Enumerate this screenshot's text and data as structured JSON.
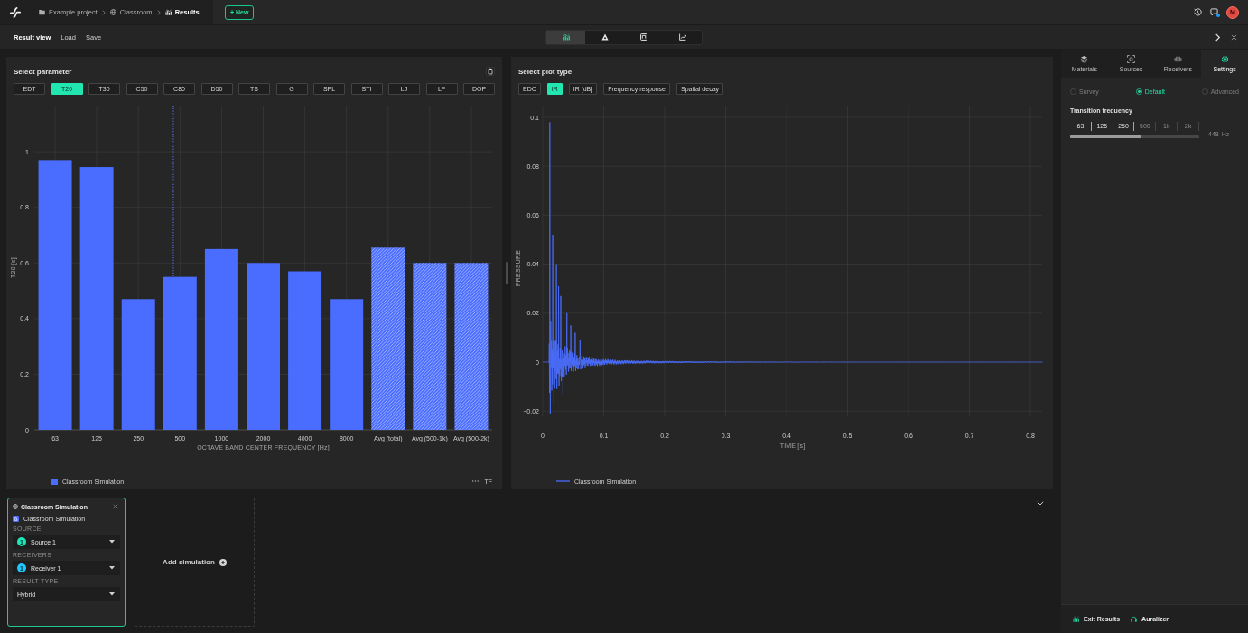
{
  "top_bar": {
    "breadcrumbs": [
      {
        "label": "Example project",
        "kind": "project",
        "selected": false
      },
      {
        "label": "Classroom",
        "kind": "model",
        "selected": false
      },
      {
        "label": "Results",
        "kind": "results",
        "selected": true
      }
    ],
    "new_button": "+ New",
    "chat_notification": true,
    "avatar": "M"
  },
  "toolbar": {
    "items": [
      {
        "label": "Result view",
        "selected": true
      },
      {
        "label": "Load",
        "selected": false
      },
      {
        "label": "Save",
        "selected": false
      }
    ],
    "views": [
      {
        "kind": "bar_chart",
        "selected": true
      },
      {
        "kind": "pyramid",
        "selected": false
      },
      {
        "kind": "framed_square",
        "selected": false
      },
      {
        "kind": "trend",
        "selected": false
      }
    ]
  },
  "parameter_panel": {
    "title": "Select parameter",
    "parameters": [
      {
        "label": "EDT",
        "selected": false
      },
      {
        "label": "T20",
        "selected": true
      },
      {
        "label": "T30",
        "selected": false
      },
      {
        "label": "C50",
        "selected": false
      },
      {
        "label": "C80",
        "selected": false
      },
      {
        "label": "D50",
        "selected": false
      },
      {
        "label": "TS",
        "selected": false
      },
      {
        "label": "G",
        "selected": false
      },
      {
        "label": "SPL",
        "selected": false
      },
      {
        "label": "STI",
        "selected": false
      },
      {
        "label": "LJ",
        "selected": false
      },
      {
        "label": "LF",
        "selected": false
      },
      {
        "label": "DOP",
        "selected": false
      }
    ],
    "chart_data": {
      "type": "bar",
      "xlabel": "OCTAVE BAND CENTER FREQUENCY [Hz]",
      "ylabel": "T20 [s]",
      "categories": [
        "63",
        "125",
        "250",
        "500",
        "1000",
        "2000",
        "4000",
        "8000",
        "Avg (total)",
        "Avg (500-1k)",
        "Avg (500-2k)"
      ],
      "series": [
        {
          "name": "Classroom Simulation",
          "color": "#4a6dff",
          "values": [
            0.97,
            0.945,
            0.47,
            0.55,
            0.65,
            0.6,
            0.57,
            0.47,
            0.655,
            0.6,
            0.6
          ]
        }
      ],
      "ylim": [
        0,
        1.166
      ],
      "yticks": [
        0,
        0.2,
        0.4,
        0.6,
        0.8,
        1
      ],
      "grid": true
    },
    "bar_hatched": [
      false,
      false,
      false,
      false,
      false,
      false,
      false,
      false,
      true,
      true,
      true
    ],
    "marker_legend": "TF"
  },
  "plot_panel": {
    "title": "Select plot type",
    "plot_types": [
      {
        "label": "EDC",
        "selected": false
      },
      {
        "label": "IR",
        "selected": true
      },
      {
        "label": "IR [dB]",
        "selected": false
      },
      {
        "label": "Frequency response",
        "selected": false
      },
      {
        "label": "Spatial decay",
        "selected": false
      }
    ],
    "plot": {
      "xlabel": "TIME [s]",
      "ylabel": "PRESSURE",
      "x_tick_labels": [
        "0",
        "0.1",
        "0.2",
        "0.3",
        "0.4",
        "0.5",
        "0.6",
        "0.7",
        "0.8"
      ],
      "y_tick_labels": [
        "0.1",
        "0.08",
        "0.06",
        "0.04",
        "0.02",
        "0",
        "−0.02"
      ]
    },
    "legend": [
      {
        "label": "Classroom Simulation"
      }
    ]
  },
  "simulation_cards": [
    {
      "selected": true,
      "title": "Classroom Simulation",
      "simulation": "Classroom Simulation",
      "fields": [
        {
          "label": "SOURCE",
          "value": "Source 1",
          "badge": "1",
          "color": "#1de9b6"
        },
        {
          "label": "RECEIVERS",
          "value": "Receiver 1",
          "badge": "1",
          "color": "#1ec8ff"
        },
        {
          "label": "RESULT TYPE",
          "value": "Hybrid"
        }
      ]
    }
  ],
  "add_simulation": {
    "label": "Add simulation"
  },
  "sidebar": {
    "tabs": [
      {
        "label": "Materials",
        "kind": "materials",
        "selected": false
      },
      {
        "label": "Sources",
        "kind": "sources",
        "selected": false
      },
      {
        "label": "Receivers",
        "kind": "receivers",
        "selected": false
      },
      {
        "label": "Settings",
        "kind": "settings",
        "selected": true
      }
    ],
    "modes": [
      {
        "label": "Survey",
        "selected": false
      },
      {
        "label": "Default",
        "selected": true
      },
      {
        "label": "Advanced",
        "selected": false
      }
    ],
    "transition_frequency": {
      "label": "Transition frequency",
      "ticks": [
        {
          "label": "63",
          "active": true
        },
        {
          "label": "125",
          "active": true
        },
        {
          "label": "250",
          "active": true
        },
        {
          "label": "500",
          "active": false
        },
        {
          "label": "1k",
          "active": false
        },
        {
          "label": "2k",
          "active": false
        }
      ],
      "level": 0.55,
      "value": "448",
      "unit": "Hz"
    },
    "footer": [
      {
        "label": "Exit Results",
        "kind": "exit_results"
      },
      {
        "label": "Auralizer",
        "kind": "auralizer"
      }
    ]
  }
}
